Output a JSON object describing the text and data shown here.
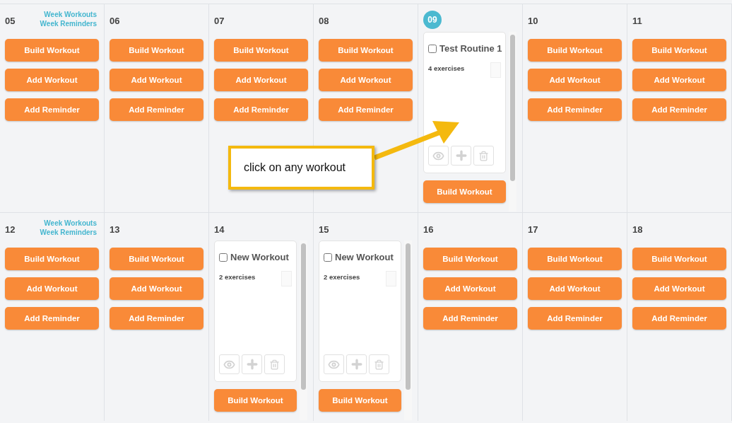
{
  "weeks": [
    {
      "days": [
        {
          "day": "05",
          "today": false,
          "week_links": [
            "Week Workouts",
            "Week Reminders"
          ],
          "kind": "buttons",
          "buttons": [
            "Build Workout",
            "Add Workout",
            "Add Reminder"
          ]
        },
        {
          "day": "06",
          "today": false,
          "kind": "buttons",
          "buttons": [
            "Build Workout",
            "Add Workout",
            "Add Reminder"
          ]
        },
        {
          "day": "07",
          "today": false,
          "kind": "buttons",
          "buttons": [
            "Build Workout",
            "Add Workout",
            "Add Reminder"
          ]
        },
        {
          "day": "08",
          "today": false,
          "kind": "buttons",
          "buttons": [
            "Build Workout",
            "Add Workout",
            "Add Reminder"
          ]
        },
        {
          "day": "09",
          "today": true,
          "kind": "workouts",
          "workouts": [
            {
              "title": "Test Routine 1",
              "checked": false,
              "exercises": "4 exercises"
            }
          ],
          "buttons": [
            "Build Workout"
          ]
        },
        {
          "day": "10",
          "today": false,
          "kind": "buttons",
          "buttons": [
            "Build Workout",
            "Add Workout",
            "Add Reminder"
          ]
        },
        {
          "day": "11",
          "today": false,
          "kind": "buttons",
          "buttons": [
            "Build Workout",
            "Add Workout",
            "Add Reminder"
          ]
        }
      ]
    },
    {
      "days": [
        {
          "day": "12",
          "today": false,
          "week_links": [
            "Week Workouts",
            "Week Reminders"
          ],
          "kind": "buttons",
          "buttons": [
            "Build Workout",
            "Add Workout",
            "Add Reminder"
          ]
        },
        {
          "day": "13",
          "today": false,
          "kind": "buttons",
          "buttons": [
            "Build Workout",
            "Add Workout",
            "Add Reminder"
          ]
        },
        {
          "day": "14",
          "today": false,
          "kind": "workouts",
          "workouts": [
            {
              "title": "New Workout",
              "checked": false,
              "exercises": "2 exercises"
            }
          ],
          "buttons": [
            "Build Workout"
          ]
        },
        {
          "day": "15",
          "today": false,
          "kind": "workouts",
          "workouts": [
            {
              "title": "New Workout",
              "checked": false,
              "exercises": "2 exercises"
            }
          ],
          "buttons": [
            "Build Workout"
          ]
        },
        {
          "day": "16",
          "today": false,
          "kind": "buttons",
          "buttons": [
            "Build Workout",
            "Add Workout",
            "Add Reminder"
          ]
        },
        {
          "day": "17",
          "today": false,
          "kind": "buttons",
          "buttons": [
            "Build Workout",
            "Add Workout",
            "Add Reminder"
          ]
        },
        {
          "day": "18",
          "today": false,
          "kind": "buttons",
          "buttons": [
            "Build Workout",
            "Add Workout",
            "Add Reminder"
          ]
        }
      ]
    }
  ],
  "callout": {
    "text": "click on any workout"
  }
}
